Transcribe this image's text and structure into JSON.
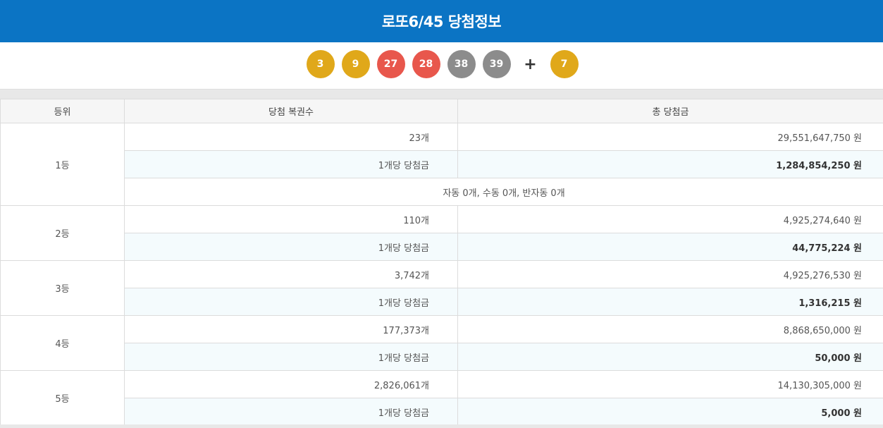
{
  "header": {
    "title": "로또6/45 당첨정보"
  },
  "numbers": {
    "main": [
      {
        "value": "3",
        "color": "#e0a81a"
      },
      {
        "value": "9",
        "color": "#e0a81a"
      },
      {
        "value": "27",
        "color": "#e8574c"
      },
      {
        "value": "28",
        "color": "#e8574c"
      },
      {
        "value": "38",
        "color": "#8c8c8c"
      },
      {
        "value": "39",
        "color": "#8c8c8c"
      }
    ],
    "plus": "+",
    "bonus": {
      "value": "7",
      "color": "#e0a81a"
    }
  },
  "table": {
    "headers": [
      "등위",
      "당첨 복권수",
      "총 당첨금"
    ],
    "per_label": "1개당 당첨금",
    "rows": [
      {
        "rank": "1등",
        "winners": "23개",
        "total": "29,551,647,750 원",
        "per_amount": "1,284,854,250 원",
        "note": "자동 0개, 수동 0개, 반자동 0개"
      },
      {
        "rank": "2등",
        "winners": "110개",
        "total": "4,925,274,640 원",
        "per_amount": "44,775,224 원"
      },
      {
        "rank": "3등",
        "winners": "3,742개",
        "total": "4,925,276,530 원",
        "per_amount": "1,316,215 원"
      },
      {
        "rank": "4등",
        "winners": "177,373개",
        "total": "8,868,650,000 원",
        "per_amount": "50,000 원"
      },
      {
        "rank": "5등",
        "winners": "2,826,061개",
        "total": "14,130,305,000 원",
        "per_amount": "5,000 원"
      }
    ]
  }
}
